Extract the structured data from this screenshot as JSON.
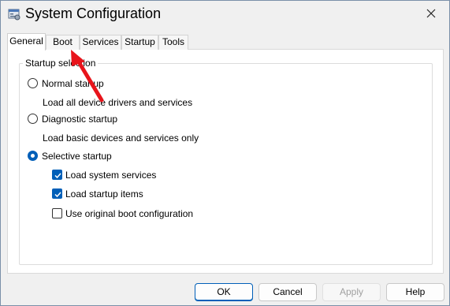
{
  "window": {
    "title": "System Configuration"
  },
  "tabs": [
    {
      "label": "General",
      "active": true
    },
    {
      "label": "Boot"
    },
    {
      "label": "Services"
    },
    {
      "label": "Startup"
    },
    {
      "label": "Tools"
    }
  ],
  "startup_selection": {
    "group_label": "Startup selection",
    "normal": {
      "label": "Normal startup",
      "description": "Load all device drivers and services",
      "selected": false
    },
    "diagnostic": {
      "label": "Diagnostic startup",
      "description": "Load basic devices and services only",
      "selected": false
    },
    "selective": {
      "label": "Selective startup",
      "selected": true,
      "options": [
        {
          "label": "Load system services",
          "checked": true
        },
        {
          "label": "Load startup items",
          "checked": true
        },
        {
          "label": "Use original boot configuration",
          "checked": false
        }
      ]
    }
  },
  "buttons": {
    "ok": "OK",
    "cancel": "Cancel",
    "apply": "Apply",
    "help": "Help"
  },
  "colors": {
    "accent": "#005fb8",
    "annotation_arrow": "#e8141b"
  }
}
